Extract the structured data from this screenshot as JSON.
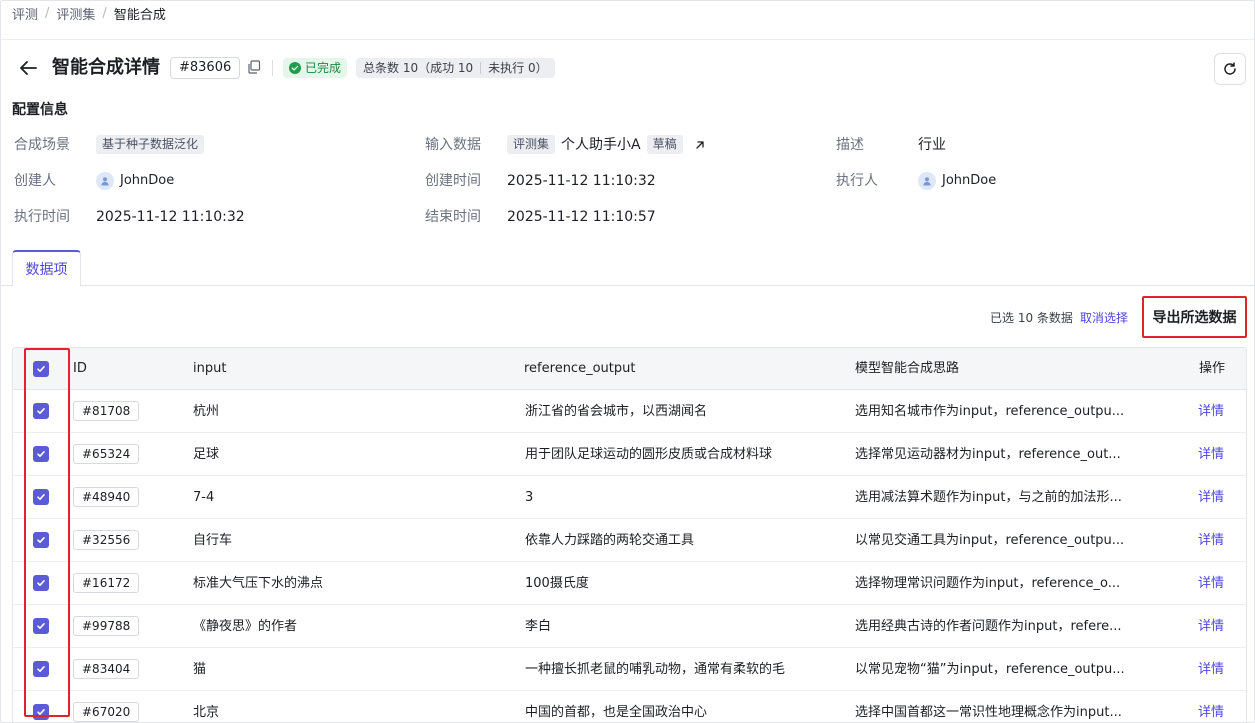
{
  "breadcrumb": {
    "items": [
      "评测",
      "评测集",
      "智能合成"
    ],
    "separator": "/"
  },
  "header": {
    "title": "智能合成详情",
    "id": "#83606",
    "status": "已完成",
    "counts": {
      "total": "总条数 10（成功 10",
      "pending": "未执行 0）"
    }
  },
  "config": {
    "title": "配置信息",
    "scene_label": "合成场景",
    "scene_value": "基于种子数据泛化",
    "input_label": "输入数据",
    "input_tag": "评测集",
    "input_name": "个人助手小A",
    "input_state": "草稿",
    "desc_label": "描述",
    "desc_value": "行业",
    "creator_label": "创建人",
    "creator_value": "JohnDoe",
    "created_label": "创建时间",
    "created_value": "2025-11-12 11:10:32",
    "executor_label": "执行人",
    "executor_value": "JohnDoe",
    "exec_time_label": "执行时间",
    "exec_time_value": "2025-11-12 11:10:32",
    "end_time_label": "结束时间",
    "end_time_value": "2025-11-12 11:10:57"
  },
  "tabs": [
    {
      "label": "数据项"
    }
  ],
  "selection": {
    "info": "已选 10 条数据",
    "cancel": "取消选择",
    "export": "导出所选数据"
  },
  "table": {
    "columns": {
      "id": "ID",
      "input": "input",
      "reference_output": "reference_output",
      "reasoning": "模型智能合成思路",
      "actions": "操作"
    },
    "action_label": "详情",
    "rows": [
      {
        "id": "#81708",
        "input": "杭州",
        "output": "浙江省的省会城市，以西湖闻名",
        "reasoning": "选用知名城市作为input，reference_outpu..."
      },
      {
        "id": "#65324",
        "input": "足球",
        "output": "用于团队足球运动的圆形皮质或合成材料球",
        "reasoning": "选择常见运动器材为input，reference_out..."
      },
      {
        "id": "#48940",
        "input": "7-4",
        "output": "3",
        "reasoning": "选用减法算术题作为input，与之前的加法形..."
      },
      {
        "id": "#32556",
        "input": "自行车",
        "output": "依靠人力踩踏的两轮交通工具",
        "reasoning": "以常见交通工具为input，reference_outpu..."
      },
      {
        "id": "#16172",
        "input": "标准大气压下水的沸点",
        "output": "100摄氏度",
        "reasoning": "选择物理常识问题作为input，reference_o..."
      },
      {
        "id": "#99788",
        "input": "《静夜思》的作者",
        "output": "李白",
        "reasoning": "选用经典古诗的作者问题作为input，refere..."
      },
      {
        "id": "#83404",
        "input": "猫",
        "output": "一种擅长抓老鼠的哺乳动物，通常有柔软的毛",
        "reasoning": "以常见宠物“猫”为input，reference_outpu..."
      },
      {
        "id": "#67020",
        "input": "北京",
        "output": "中国的首都，也是全国政治中心",
        "reasoning": "选择中国首都这一常识性地理概念作为input..."
      }
    ]
  }
}
